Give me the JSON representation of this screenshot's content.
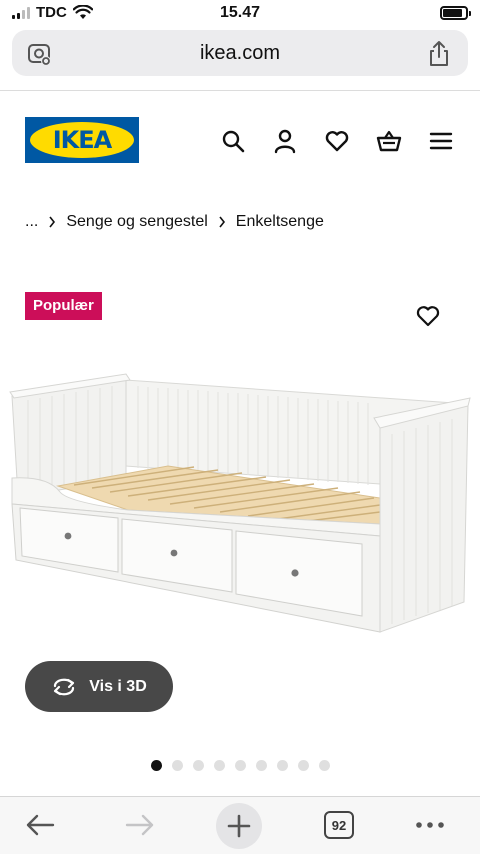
{
  "status_bar": {
    "carrier": "TDC",
    "time": "15.47",
    "battery_level": 0.85
  },
  "browser": {
    "url": "ikea.com",
    "tab_count": "92"
  },
  "header": {
    "logo_text": "IKEA"
  },
  "breadcrumb": {
    "ellipsis": "...",
    "items": [
      "Senge og sengestel",
      "Enkeltsenge"
    ]
  },
  "product": {
    "badge": "Populær",
    "view_3d_label": "Vis i 3D",
    "image_count": 9,
    "active_image": 1
  },
  "colors": {
    "ikea_blue": "#0058a3",
    "ikea_yellow": "#ffdb00",
    "badge_pink": "#cc0e59",
    "button_dark": "#484848"
  },
  "icons": {
    "header": [
      "search-icon",
      "profile-icon",
      "heart-icon",
      "basket-icon",
      "menu-icon"
    ],
    "toolbar": [
      "back-arrow-icon",
      "forward-arrow-icon",
      "plus-icon",
      "tabs-icon",
      "more-icon"
    ]
  }
}
